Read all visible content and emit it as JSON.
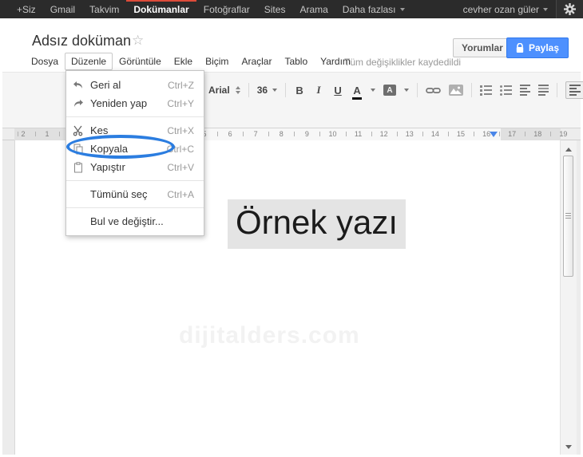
{
  "topbar": {
    "items": [
      {
        "label": "+Siz",
        "active": false,
        "caret": false
      },
      {
        "label": "Gmail",
        "active": false,
        "caret": false
      },
      {
        "label": "Takvim",
        "active": false,
        "caret": false
      },
      {
        "label": "Dokümanlar",
        "active": true,
        "caret": false
      },
      {
        "label": "Fotoğraflar",
        "active": false,
        "caret": false
      },
      {
        "label": "Sites",
        "active": false,
        "caret": false
      },
      {
        "label": "Arama",
        "active": false,
        "caret": false
      },
      {
        "label": "Daha fazlası",
        "active": false,
        "caret": true
      }
    ],
    "user_label": "cevher ozan güler",
    "active_accent_color": "#dd4b39",
    "background_color": "#2b2b2b"
  },
  "header": {
    "title": "Adsız doküman",
    "star_icon": "star-outline",
    "comments_button": "Yorumlar",
    "share_button": "Paylaş",
    "share_color": "#4d90fe"
  },
  "menubar": {
    "items": [
      "Dosya",
      "Düzenle",
      "Görüntüle",
      "Ekle",
      "Biçim",
      "Araçlar",
      "Tablo",
      "Yardım"
    ],
    "open_item": "Düzenle",
    "status": "Tüm değişiklikler kaydedildi"
  },
  "toolbar": {
    "font_family": "Arial",
    "font_size": "36",
    "bold_label": "B",
    "italic_label": "I",
    "underline_label": "U",
    "text_color_label": "A",
    "highlight_label": "A"
  },
  "edit_menu": {
    "items": [
      {
        "label": "Geri al",
        "shortcut": "Ctrl+Z",
        "icon": "undo-icon",
        "annotated": false
      },
      {
        "label": "Yeniden yap",
        "shortcut": "Ctrl+Y",
        "icon": "redo-icon",
        "annotated": false
      },
      {
        "label": "Kes",
        "shortcut": "Ctrl+X",
        "icon": "scissors-icon",
        "annotated": false
      },
      {
        "label": "Kopyala",
        "shortcut": "Ctrl+C",
        "icon": "copy-icon",
        "annotated": true
      },
      {
        "label": "Yapıştır",
        "shortcut": "Ctrl+V",
        "icon": "paste-icon",
        "annotated": false
      },
      {
        "label": "Tümünü seç",
        "shortcut": "Ctrl+A",
        "icon": "",
        "annotated": false
      },
      {
        "label": "Bul ve değiştir...",
        "shortcut": "",
        "icon": "",
        "annotated": false
      }
    ],
    "separators_after": [
      1,
      4,
      5
    ],
    "annotation_color": "#2b7de0"
  },
  "ruler": {
    "left_numbers": [
      "2",
      "1"
    ],
    "numbers": [
      "5",
      "6",
      "7",
      "8",
      "9",
      "10",
      "11",
      "12",
      "13",
      "14",
      "15",
      "16",
      "17",
      "18",
      "19"
    ]
  },
  "document": {
    "text": "Örnek yazı",
    "watermark": "dijitalders.com"
  }
}
